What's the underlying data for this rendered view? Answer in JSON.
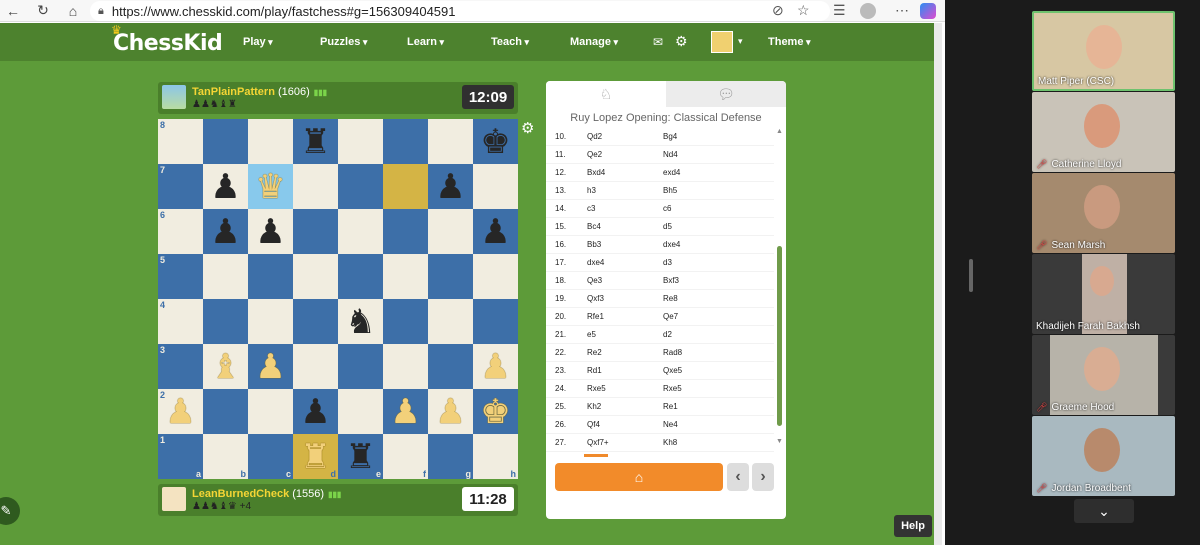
{
  "browser": {
    "url": "https://www.chesskid.com/play/fastchess#g=156309404591",
    "icons": [
      "back-icon",
      "refresh-icon",
      "home-icon",
      "lock-icon",
      "eye-off-icon",
      "star-icon",
      "favorites-icon",
      "profile-icon",
      "more-icon",
      "copilot-icon"
    ]
  },
  "site": {
    "logo": "ChessKid",
    "menu": [
      "Play",
      "Puzzles",
      "Learn",
      "Teach",
      "Manage"
    ],
    "theme_label": "Theme",
    "help_label": "Help"
  },
  "top_player": {
    "name": "TanPlainPattern",
    "rating": "(1606)",
    "bars": "▮▮▮",
    "captured": "♟♟♞♝♜",
    "clock": "12:09"
  },
  "bottom_player": {
    "name": "LeanBurnedCheck",
    "rating": "(1556)",
    "bars": "▮▮▮",
    "captured": "♟♟♞♝♛ +4",
    "clock": "11:28"
  },
  "board": {
    "files": [
      "a",
      "b",
      "c",
      "d",
      "e",
      "f",
      "g",
      "h"
    ],
    "ranks": [
      "8",
      "7",
      "6",
      "5",
      "4",
      "3",
      "2",
      "1"
    ],
    "highlighted_squares": [
      "c7",
      "f7",
      "d1"
    ],
    "pieces": {
      "d8": "br",
      "h8": "bk",
      "b7": "bp",
      "c7": "wq",
      "g7": "bp",
      "b6": "bp",
      "c6": "bp",
      "h6": "bp",
      "e4": "bn",
      "b3": "wb",
      "c3": "wp",
      "h3": "wp",
      "a2": "wp",
      "d2": "bp",
      "f2": "wp",
      "g2": "wp",
      "h2": "wk",
      "d1": "wr",
      "e1": "br"
    }
  },
  "moves_panel": {
    "opening": "Ruy Lopez Opening: Classical Defense",
    "moves": [
      {
        "n": "10.",
        "w": "Qd2",
        "b": "Bg4"
      },
      {
        "n": "11.",
        "w": "Qe2",
        "b": "Nd4"
      },
      {
        "n": "12.",
        "w": "Bxd4",
        "b": "exd4"
      },
      {
        "n": "13.",
        "w": "h3",
        "b": "Bh5"
      },
      {
        "n": "14.",
        "w": "c3",
        "b": "c6"
      },
      {
        "n": "15.",
        "w": "Bc4",
        "b": "d5"
      },
      {
        "n": "16.",
        "w": "Bb3",
        "b": "dxe4"
      },
      {
        "n": "17.",
        "w": "dxe4",
        "b": "d3"
      },
      {
        "n": "18.",
        "w": "Qe3",
        "b": "Bxf3"
      },
      {
        "n": "19.",
        "w": "Qxf3",
        "b": "Re8"
      },
      {
        "n": "20.",
        "w": "Rfe1",
        "b": "Qe7"
      },
      {
        "n": "21.",
        "w": "e5",
        "b": "d2"
      },
      {
        "n": "22.",
        "w": "Re2",
        "b": "Rad8"
      },
      {
        "n": "23.",
        "w": "Rd1",
        "b": "Qxe5"
      },
      {
        "n": "24.",
        "w": "Rxe5",
        "b": "Rxe5"
      },
      {
        "n": "25.",
        "w": "Kh2",
        "b": "Re1"
      },
      {
        "n": "26.",
        "w": "Qf4",
        "b": "Ne4"
      },
      {
        "n": "27.",
        "w": "Qxf7+",
        "b": "Kh8"
      }
    ]
  },
  "participants": [
    {
      "name": "Matt Piper (CSC)",
      "muted": false,
      "active": true,
      "bg": "#d7c7a3",
      "face": "#e6b596"
    },
    {
      "name": "Catherine Lloyd",
      "muted": true,
      "active": false,
      "bg": "#c9c3b8",
      "face": "#d99a7c"
    },
    {
      "name": "Sean Marsh",
      "muted": true,
      "active": false,
      "bg": "#a58a6e",
      "face": "#c99a7f"
    },
    {
      "name": "Khadijeh Farah Bakhsh",
      "muted": false,
      "active": false,
      "bg": "#bfb0a5",
      "face": "#d8a990"
    },
    {
      "name": "Graeme Hood",
      "muted": true,
      "active": false,
      "bg": "#b7b3a9",
      "face": "#d9ad93"
    },
    {
      "name": "Jordan Broadbent",
      "muted": true,
      "active": false,
      "bg": "#a9b9c0",
      "face": "#b88a6c"
    }
  ]
}
